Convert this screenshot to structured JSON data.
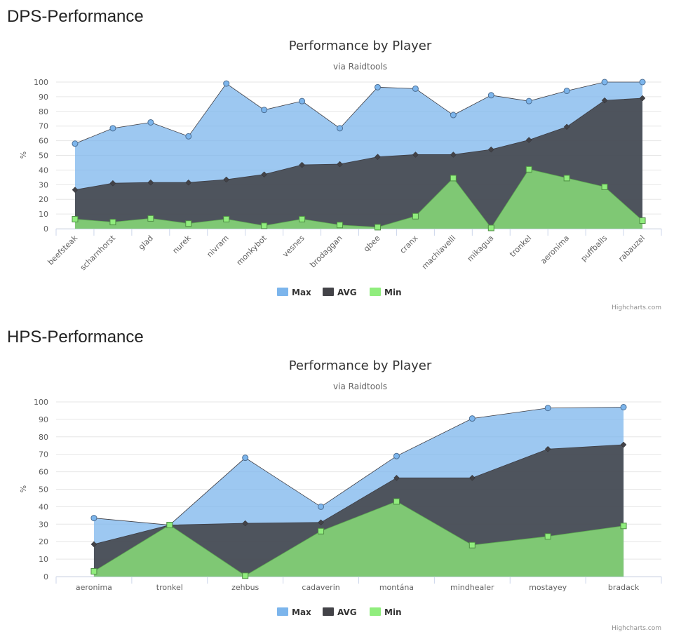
{
  "sections": [
    {
      "title": "DPS-Performance",
      "credits": "Highcharts.com"
    },
    {
      "title": "HPS-Performance",
      "credits": "Highcharts.com"
    }
  ],
  "colors": {
    "max": "#7cb5ec",
    "avg": "#434348",
    "min": "#90ed7d",
    "grid": "#e6e6e6"
  },
  "chart_data": [
    {
      "type": "area",
      "title": "Performance by Player",
      "subtitle": "via Raidtools",
      "ylabel": "%",
      "xlabel": "",
      "ylim": [
        0,
        100
      ],
      "yticks": [
        0,
        10,
        20,
        30,
        40,
        50,
        60,
        70,
        80,
        90,
        100
      ],
      "grid": true,
      "legend": "bottom-center",
      "categories": [
        "beefsteak",
        "scharnhorst",
        "glad",
        "nurek",
        "nivram",
        "monkybot",
        "vesnes",
        "brodaggan",
        "qbee",
        "cranx",
        "machiavelli",
        "mikagua",
        "tronkel",
        "aeronima",
        "puffballs",
        "rabauzel"
      ],
      "series": [
        {
          "name": "Max",
          "values": [
            58,
            68.5,
            72.5,
            63,
            99,
            81,
            87,
            68.5,
            96.5,
            95.5,
            77.5,
            91,
            87,
            94,
            100,
            100
          ]
        },
        {
          "name": "AVG",
          "values": [
            26.5,
            31,
            31.5,
            31.5,
            33.5,
            37,
            43.5,
            44,
            49,
            50.5,
            50.5,
            54,
            60.5,
            69.5,
            87.5,
            89
          ]
        },
        {
          "name": "Min",
          "values": [
            6.5,
            4.5,
            7,
            3.5,
            6.5,
            2,
            6.5,
            2.5,
            1,
            8.5,
            34.5,
            0.5,
            40.5,
            34.5,
            28.5,
            5.5
          ]
        }
      ]
    },
    {
      "type": "area",
      "title": "Performance by Player",
      "subtitle": "via Raidtools",
      "ylabel": "%",
      "xlabel": "",
      "ylim": [
        0,
        100
      ],
      "yticks": [
        0,
        10,
        20,
        30,
        40,
        50,
        60,
        70,
        80,
        90,
        100
      ],
      "grid": true,
      "legend": "bottom-center",
      "categories": [
        "aeronima",
        "tronkel",
        "zehbus",
        "cadaverin",
        "montána",
        "mindhealer",
        "mostayey",
        "bradack"
      ],
      "series": [
        {
          "name": "Max",
          "values": [
            33.5,
            29.5,
            68,
            40,
            69,
            90.5,
            96.5,
            97
          ]
        },
        {
          "name": "AVG",
          "values": [
            18.5,
            29.5,
            30.5,
            31,
            56.5,
            56.5,
            73,
            75.5
          ]
        },
        {
          "name": "Min",
          "values": [
            3,
            29.5,
            0.5,
            26,
            43,
            18,
            23,
            29
          ]
        }
      ]
    }
  ]
}
